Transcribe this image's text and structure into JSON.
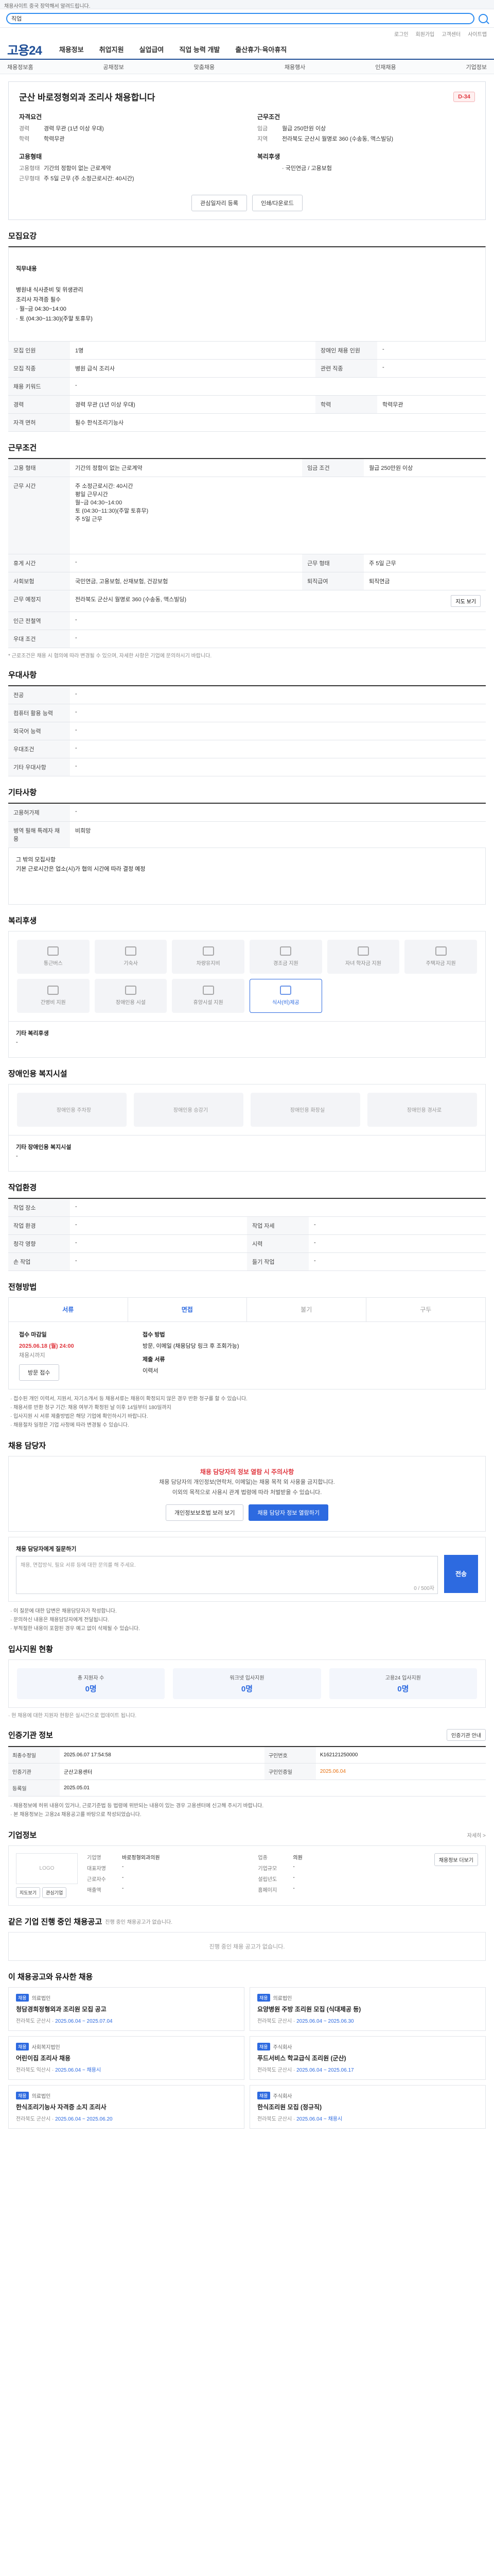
{
  "top": {
    "notice": "채용사이트 중국 장악해서 알려드립니다.",
    "search_tag": "직업",
    "search_placeholder": "",
    "util": [
      "로그인",
      "회원가입",
      "고객센터",
      "사이트맵"
    ]
  },
  "nav": {
    "logo": "고용24",
    "items": [
      "채용정보",
      "취업지원",
      "실업급여",
      "직업 능력 개발",
      "출산휴가·육아휴직"
    ],
    "sub": [
      "채용정보홈",
      "공채정보",
      "맞춤채용",
      "채용행사",
      "인재채용",
      "기업정보"
    ]
  },
  "summary": {
    "title": "군산 바로정형외과 조리사 채용합니다",
    "dday": "D-34",
    "left_heading": "자격요건",
    "left": [
      {
        "k": "경력",
        "v": "경력 무관 (1년 이상 우대)"
      },
      {
        "k": "학력",
        "v": "학력무관"
      }
    ],
    "right_heading": "근무조건",
    "right": [
      {
        "k": "임금",
        "v": "월급 250만원 이상"
      },
      {
        "k": "지역",
        "v": "전라북도 군산시 월명로 360 (수송동, 액스빌딩)"
      }
    ],
    "left2_heading": "고용형태",
    "left2": [
      {
        "k": "고용형태",
        "v": "기간의 정함이 없는 근로계약"
      },
      {
        "k": "근무형태",
        "v": "주 5일 근무 (주 소정근로시간: 40시간)"
      }
    ],
    "right2_heading": "복리후생",
    "right2": [
      {
        "k": "",
        "v": "· 국민연금 / 고용보험"
      }
    ],
    "btn_interest": "관심일자리 등록",
    "btn_apply": "인쇄/다운로드",
    "note": ""
  },
  "recruit": {
    "title": "모집요강",
    "duty_label": "직무내용",
    "duty_text": "병원내 식사준비 및 위생관리\n조리사 자격증 필수\n· 월~금 04:30~14:00\n· 토 (04:30~11:30)(주말 토휴무)",
    "rows": [
      {
        "k": "모집 인원",
        "v": "1명",
        "k2": "장애인 채용 인원",
        "v2": "-"
      },
      {
        "k": "모집 직종",
        "v": "병원 급식 조리사",
        "k2": "관련 직종",
        "v2": "-"
      },
      {
        "k": "채용 키워드",
        "v": "-",
        "k2": "",
        "v2": ""
      },
      {
        "k": "경력",
        "v": "경력 무관 (1년 이상 우대)",
        "k2": "학력",
        "v2": "학력무관"
      },
      {
        "k": "자격 면허",
        "v": "필수 한식조리기능사",
        "k2": "",
        "v2": ""
      }
    ]
  },
  "conditions": {
    "title": "근무조건",
    "rows": [
      {
        "k": "고용 형태",
        "v": "기간의 정함이 없는 근로계약",
        "k2": "임금 조건",
        "v2": "월급 250만원 이상"
      },
      {
        "k": "근무 시간",
        "v": "주 소정근로시간: 40시간\n평일 근무시간\n월~금 04:30~14:00\n토 (04:30~11:30)(주말 토휴무)\n주 5일 근무",
        "k2": "",
        "v2": ""
      },
      {
        "k": "휴게 시간",
        "v": "-",
        "k2": "근무 형태",
        "v2": "주 5일 근무"
      },
      {
        "k": "사회보험",
        "v": "국민연금, 고용보험, 산재보험, 건강보험",
        "k2": "퇴직급여",
        "v2": "퇴직연금"
      },
      {
        "k": "근무 예정지",
        "v": "전라북도 군산시 월명로 360 (수송동, 액스빌딩)",
        "k2": "",
        "v2": ""
      },
      {
        "k": "인근 전철역",
        "v": "-",
        "k2": "",
        "v2": ""
      },
      {
        "k": "우대 조건",
        "v": "-",
        "k2": "",
        "v2": ""
      }
    ],
    "map_btn": "지도 보기",
    "note": "* 근로조건은 채용 시 협의에 따라 변경될 수 있으며, 자세한 사항은 기업에 문의하시기 바랍니다."
  },
  "preference": {
    "title": "우대사항",
    "rows": [
      {
        "k": "전공",
        "v": "-"
      },
      {
        "k": "컴퓨터 활용 능력",
        "v": "-"
      },
      {
        "k": "외국어 능력",
        "v": "-"
      },
      {
        "k": "우대조건",
        "v": "-"
      },
      {
        "k": "기타 우대사항",
        "v": "-"
      }
    ]
  },
  "etc": {
    "title": "기타사항",
    "rows": [
      {
        "k": "고용허가제",
        "v": "-"
      },
      {
        "k": "병역 필해 특례자 채용",
        "v": "비희망"
      }
    ],
    "text": "그 밖의 모집사항\n기본 근로시간은 업소(시)가 협의 시간에 따라 결정 예정"
  },
  "welfare": {
    "title": "복리후생",
    "items": [
      "통근버스",
      "기숙사",
      "차량유지비",
      "경조금 지원",
      "자녀 학자금 지원",
      "주택자금 지원",
      "간병비 지원",
      "장애인용 시설",
      "휴양시설 지원",
      "식사(비)제공"
    ],
    "active_index": 9,
    "extra_label": "기타 복리후생",
    "extra_value": "-"
  },
  "disability": {
    "title": "장애인용 복지시설",
    "items": [
      "장애인용 주차장",
      "장애인용 승강기",
      "장애인용 화장실",
      "장애인용 경사로"
    ],
    "extra_label": "기타 장애인용 복지시설",
    "extra_value": "-"
  },
  "workplace": {
    "title": "작업환경",
    "rows": [
      {
        "k": "작업 장소",
        "v": "-",
        "k2": "",
        "v2": ""
      },
      {
        "k": "작업 환경",
        "v": "-",
        "k2": "작업 자세",
        "v2": "-"
      },
      {
        "k": "청각 영향",
        "v": "-",
        "k2": "시력",
        "v2": "-"
      },
      {
        "k": "손 작업",
        "v": "-",
        "k2": "들기 작업",
        "v2": "-"
      }
    ]
  },
  "process": {
    "title": "전형방법",
    "steps": [
      "서류",
      "면접",
      "불기",
      "구두"
    ],
    "deadline_label": "접수 마감일",
    "deadline": "2025.06.18 (월) 24:00",
    "deadline_note": "채용시까지",
    "method_label": "접수 방법",
    "method": "방문, 이메일 (채용담당 링크 후 조회가능)",
    "docs_label": "제출 서류",
    "docs": "이력서",
    "apply_btn": "방문 접수",
    "bullets": [
      "· 접수된 개인 이력서, 지원서, 자기소개서 등 채용서류는 채용이 확정되지 않은 경우 반환 청구를 할 수 있습니다.",
      "· 채용서류 반환 청구 기간: 채용 여부가 확정된 날 이후 14일부터 180일까지",
      "· 입사지원 시 서류 제출방법은 해당 기업에 확인하시기 바랍니다.",
      "· 채용절차 일정은 기업 사정에 따라 변경될 수 있습니다."
    ]
  },
  "contact": {
    "title": "채용 담당자",
    "warn_title": "채용 담당자의 정보 열람 시 주의사항",
    "warn_text": "채용 담당자의 개인정보(연락처, 이메일)는 채용 목적 외 사용을 금지합니다.\n이외의 목적으로 사용시 관계 법령에 따라 처벌받을 수 있습니다.",
    "btn_personal": "개인정보보호법 보러 보기",
    "btn_view": "채용 담당자 정보 열람하기",
    "inq_label": "채용 담당자에게 질문하기",
    "inq_placeholder": "채용, 면접방식, 필요 서류 등에 대한 문의를 해 주세요.",
    "inq_count": "0 / 500자",
    "send": "전송",
    "notes": [
      "· 이 질문에 대한 답변은 채용담당자가 작성합니다.",
      "· 문의하신 내용은 채용담당자에게 전달됩니다.",
      "· 부적절한 내용이 포함된 경우 예고 없이 삭제될 수 있습니다."
    ]
  },
  "applicants": {
    "title": "입사지원 현황",
    "stats": [
      {
        "label": "총 지원자 수",
        "value": "0명"
      },
      {
        "label": "워크넷 입사지원",
        "value": "0명"
      },
      {
        "label": "고용24 입사지원",
        "value": "0명"
      }
    ],
    "note": "· 현 채용에 대한 지원자 현황은 실시간으로 업데이트 됩니다."
  },
  "job_info": {
    "title": "인증기관 정보",
    "btn": "인증기관 안내",
    "rows": [
      {
        "k": "최종수정일",
        "v": "2025.06.07 17:54:58",
        "k2": "구인번호",
        "v2": "K162121250000"
      },
      {
        "k": "인증기관",
        "v": "군산고용센터",
        "k2": "구인인증일",
        "v2": "2025.06.04"
      },
      {
        "k": "등록일",
        "v": "2025.05.01",
        "k2": "",
        "v2": ""
      }
    ],
    "notes": [
      "· 채용정보에 허위 내용이 있거나, 근로기준법 등 법령에 위반되는 내용이 있는 경우 고용센터에 신고해 주시기 바랍니다.",
      "· 본 채용정보는 고용24 채용공고를 바탕으로 작성되었습니다."
    ]
  },
  "company": {
    "title": "기업정보",
    "detail": "자세히 >",
    "logo_alt": "LOGO",
    "grid": [
      {
        "k": "기업명",
        "v": "바로정형외과의원"
      },
      {
        "k": "업종",
        "v": "의원"
      },
      {
        "k": "대표자명",
        "v": "-"
      },
      {
        "k": "기업규모",
        "v": "-"
      },
      {
        "k": "근로자수",
        "v": "-"
      },
      {
        "k": "설립년도",
        "v": "-"
      },
      {
        "k": "매출액",
        "v": "-"
      },
      {
        "k": "홈페이지",
        "v": "-"
      }
    ],
    "btn_map": "지도보기",
    "btn_interest": "관심기업",
    "btn_more": "채용정보 더보기"
  },
  "other_jobs": {
    "title": "같은 기업 진행 중인 채용공고",
    "sub": "진행 중인 채용공고가 없습니다.",
    "empty": "진행 중인 채용 공고가 없습니다."
  },
  "recommend": {
    "title": "이 채용공고와 유사한 채용",
    "items": [
      {
        "co": "의료법인",
        "title": "청담경희정형외과 조리원 모집 공고",
        "region": "전라북도 군산시",
        "date": "2025.06.04 ~ 2025.07.04"
      },
      {
        "co": "의료법인",
        "title": "요양병원 주방 조리원 모집 (식대제공 등)",
        "region": "전라북도 군산시",
        "date": "2025.06.04 ~ 2025.06.30"
      },
      {
        "co": "사회복지법인",
        "title": "어린이집 조리사 채용",
        "region": "전라북도 익산시",
        "date": "2025.06.04 ~ 채용시"
      },
      {
        "co": "주식회사",
        "title": "푸드서비스 학교급식 조리원 (군산)",
        "region": "전라북도 군산시",
        "date": "2025.06.04 ~ 2025.06.17"
      },
      {
        "co": "의료법인",
        "title": "한식조리기능사 자격증 소지 조리사",
        "region": "전라북도 군산시",
        "date": "2025.06.04 ~ 2025.06.20"
      },
      {
        "co": "주식회사",
        "title": "한식조리원 모집 (정규직)",
        "region": "전라북도 군산시",
        "date": "2025.06.04 ~ 채용시"
      }
    ]
  }
}
